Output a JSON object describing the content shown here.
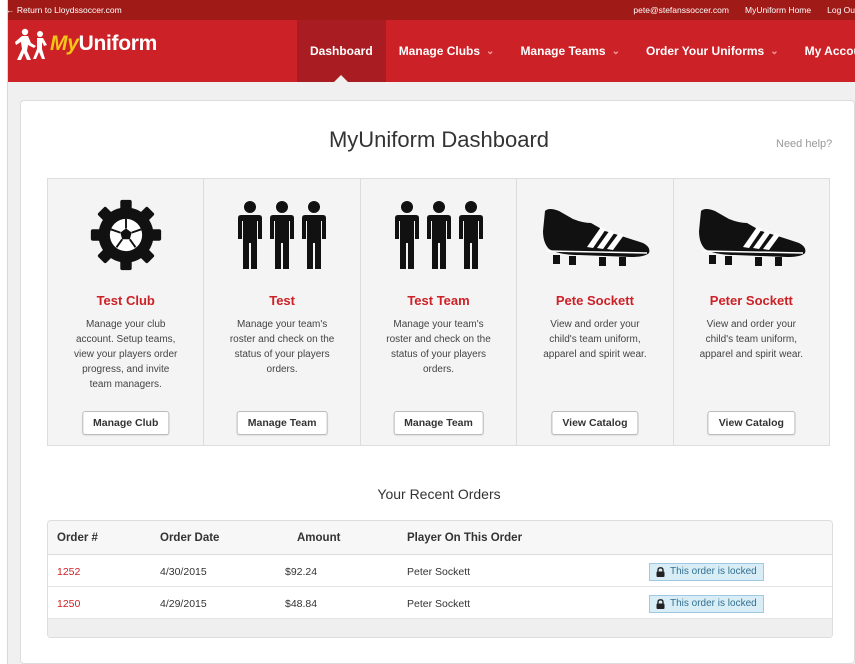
{
  "topbar": {
    "back_label": "← Return to Lloydssoccer.com",
    "email": "pete@stefanssoccer.com",
    "home_label": "MyUniform Home",
    "logout_label": "Log Ou"
  },
  "brand": {
    "my": "My",
    "uniform": "Uniform"
  },
  "nav": {
    "items": [
      {
        "label": "Dashboard",
        "caret": ""
      },
      {
        "label": "Manage Clubs",
        "caret": "⌄"
      },
      {
        "label": "Manage Teams",
        "caret": "⌄"
      },
      {
        "label": "Order Your Uniforms",
        "caret": "⌄"
      },
      {
        "label": "My Account",
        "caret": ""
      }
    ]
  },
  "page": {
    "title": "MyUniform Dashboard",
    "help_label": "Need help?"
  },
  "cards": [
    {
      "icon": "gear-ball-icon",
      "title": "Test Club",
      "text": "Manage your club account. Setup teams, view your players order progress, and invite team managers.",
      "button": "Manage Club"
    },
    {
      "icon": "team-players-icon",
      "title": "Test",
      "text": "Manage your team's roster and check on the status of your players orders.",
      "button": "Manage Team"
    },
    {
      "icon": "team-players-icon",
      "title": "Test Team",
      "text": "Manage your team's roster and check on the status of your players orders.",
      "button": "Manage Team"
    },
    {
      "icon": "soccer-cleat-icon",
      "title": "Pete Sockett",
      "text": "View and order your child's team uniform, apparel and spirit wear.",
      "button": "View Catalog"
    },
    {
      "icon": "soccer-cleat-icon",
      "title": "Peter Sockett",
      "text": "View and order your child's team uniform, apparel and spirit wear.",
      "button": "View Catalog"
    }
  ],
  "orders": {
    "title": "Your Recent Orders",
    "columns": [
      "Order #",
      "Order Date",
      "Amount",
      "Player On This Order"
    ],
    "rows": [
      {
        "order": "1252",
        "date": "4/30/2015",
        "amount": "$92.24",
        "player": "Peter Sockett",
        "status": "This order is locked"
      },
      {
        "order": "1250",
        "date": "4/29/2015",
        "amount": "$48.84",
        "player": "Peter Sockett",
        "status": "This order is locked"
      }
    ]
  },
  "colors": {
    "brand_red": "#cc2127",
    "dark_red": "#a01b17",
    "accent_yellow": "#f4c518"
  }
}
